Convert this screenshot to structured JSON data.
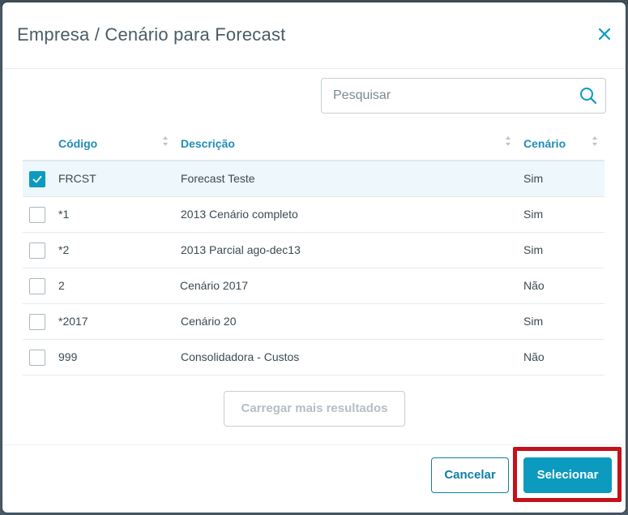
{
  "dialog": {
    "title": "Empresa / Cenário para Forecast"
  },
  "search": {
    "placeholder": "Pesquisar",
    "value": ""
  },
  "table": {
    "columns": [
      "Código",
      "Descrição",
      "Cenário"
    ],
    "rows": [
      {
        "checked": true,
        "codigo": "FRCST",
        "descricao": "Forecast Teste",
        "cenario": "Sim"
      },
      {
        "checked": false,
        "codigo": "*1",
        "descricao": "2013 Cenário completo",
        "cenario": "Sim"
      },
      {
        "checked": false,
        "codigo": "*2",
        "descricao": "2013 Parcial ago-dec13",
        "cenario": "Sim"
      },
      {
        "checked": false,
        "codigo": "2",
        "descricao": "Cenário 2017",
        "cenario": "Não"
      },
      {
        "checked": false,
        "codigo": "*2017",
        "descricao": "Cenário 20",
        "cenario": "Sim"
      },
      {
        "checked": false,
        "codigo": "999",
        "descricao": "Consolidadora - Custos",
        "cenario": "Não"
      }
    ]
  },
  "actions": {
    "load_more": "Carregar mais resultados",
    "cancel": "Cancelar",
    "select": "Selecionar"
  },
  "colors": {
    "accent": "#0c9abe",
    "header_text": "#1f8db5",
    "highlight": "#c4121a"
  },
  "icons": {
    "close": "close-icon",
    "search": "search-icon",
    "sort": "sort-icon",
    "check": "check-icon"
  }
}
